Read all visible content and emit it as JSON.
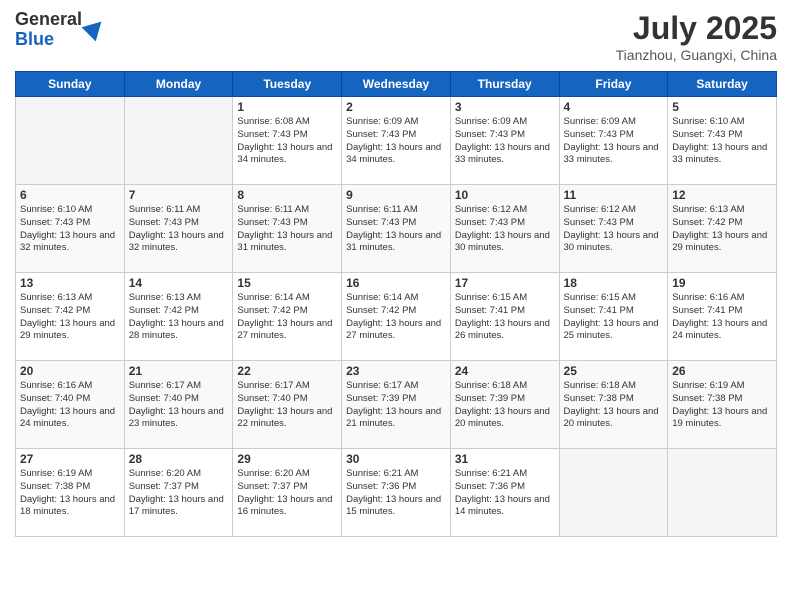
{
  "logo": {
    "general": "General",
    "blue": "Blue"
  },
  "header": {
    "month": "July 2025",
    "location": "Tianzhou, Guangxi, China"
  },
  "weekdays": [
    "Sunday",
    "Monday",
    "Tuesday",
    "Wednesday",
    "Thursday",
    "Friday",
    "Saturday"
  ],
  "weeks": [
    [
      {
        "day": "",
        "info": ""
      },
      {
        "day": "",
        "info": ""
      },
      {
        "day": "1",
        "info": "Sunrise: 6:08 AM\nSunset: 7:43 PM\nDaylight: 13 hours and 34 minutes."
      },
      {
        "day": "2",
        "info": "Sunrise: 6:09 AM\nSunset: 7:43 PM\nDaylight: 13 hours and 34 minutes."
      },
      {
        "day": "3",
        "info": "Sunrise: 6:09 AM\nSunset: 7:43 PM\nDaylight: 13 hours and 33 minutes."
      },
      {
        "day": "4",
        "info": "Sunrise: 6:09 AM\nSunset: 7:43 PM\nDaylight: 13 hours and 33 minutes."
      },
      {
        "day": "5",
        "info": "Sunrise: 6:10 AM\nSunset: 7:43 PM\nDaylight: 13 hours and 33 minutes."
      }
    ],
    [
      {
        "day": "6",
        "info": "Sunrise: 6:10 AM\nSunset: 7:43 PM\nDaylight: 13 hours and 32 minutes."
      },
      {
        "day": "7",
        "info": "Sunrise: 6:11 AM\nSunset: 7:43 PM\nDaylight: 13 hours and 32 minutes."
      },
      {
        "day": "8",
        "info": "Sunrise: 6:11 AM\nSunset: 7:43 PM\nDaylight: 13 hours and 31 minutes."
      },
      {
        "day": "9",
        "info": "Sunrise: 6:11 AM\nSunset: 7:43 PM\nDaylight: 13 hours and 31 minutes."
      },
      {
        "day": "10",
        "info": "Sunrise: 6:12 AM\nSunset: 7:43 PM\nDaylight: 13 hours and 30 minutes."
      },
      {
        "day": "11",
        "info": "Sunrise: 6:12 AM\nSunset: 7:43 PM\nDaylight: 13 hours and 30 minutes."
      },
      {
        "day": "12",
        "info": "Sunrise: 6:13 AM\nSunset: 7:42 PM\nDaylight: 13 hours and 29 minutes."
      }
    ],
    [
      {
        "day": "13",
        "info": "Sunrise: 6:13 AM\nSunset: 7:42 PM\nDaylight: 13 hours and 29 minutes."
      },
      {
        "day": "14",
        "info": "Sunrise: 6:13 AM\nSunset: 7:42 PM\nDaylight: 13 hours and 28 minutes."
      },
      {
        "day": "15",
        "info": "Sunrise: 6:14 AM\nSunset: 7:42 PM\nDaylight: 13 hours and 27 minutes."
      },
      {
        "day": "16",
        "info": "Sunrise: 6:14 AM\nSunset: 7:42 PM\nDaylight: 13 hours and 27 minutes."
      },
      {
        "day": "17",
        "info": "Sunrise: 6:15 AM\nSunset: 7:41 PM\nDaylight: 13 hours and 26 minutes."
      },
      {
        "day": "18",
        "info": "Sunrise: 6:15 AM\nSunset: 7:41 PM\nDaylight: 13 hours and 25 minutes."
      },
      {
        "day": "19",
        "info": "Sunrise: 6:16 AM\nSunset: 7:41 PM\nDaylight: 13 hours and 24 minutes."
      }
    ],
    [
      {
        "day": "20",
        "info": "Sunrise: 6:16 AM\nSunset: 7:40 PM\nDaylight: 13 hours and 24 minutes."
      },
      {
        "day": "21",
        "info": "Sunrise: 6:17 AM\nSunset: 7:40 PM\nDaylight: 13 hours and 23 minutes."
      },
      {
        "day": "22",
        "info": "Sunrise: 6:17 AM\nSunset: 7:40 PM\nDaylight: 13 hours and 22 minutes."
      },
      {
        "day": "23",
        "info": "Sunrise: 6:17 AM\nSunset: 7:39 PM\nDaylight: 13 hours and 21 minutes."
      },
      {
        "day": "24",
        "info": "Sunrise: 6:18 AM\nSunset: 7:39 PM\nDaylight: 13 hours and 20 minutes."
      },
      {
        "day": "25",
        "info": "Sunrise: 6:18 AM\nSunset: 7:38 PM\nDaylight: 13 hours and 20 minutes."
      },
      {
        "day": "26",
        "info": "Sunrise: 6:19 AM\nSunset: 7:38 PM\nDaylight: 13 hours and 19 minutes."
      }
    ],
    [
      {
        "day": "27",
        "info": "Sunrise: 6:19 AM\nSunset: 7:38 PM\nDaylight: 13 hours and 18 minutes."
      },
      {
        "day": "28",
        "info": "Sunrise: 6:20 AM\nSunset: 7:37 PM\nDaylight: 13 hours and 17 minutes."
      },
      {
        "day": "29",
        "info": "Sunrise: 6:20 AM\nSunset: 7:37 PM\nDaylight: 13 hours and 16 minutes."
      },
      {
        "day": "30",
        "info": "Sunrise: 6:21 AM\nSunset: 7:36 PM\nDaylight: 13 hours and 15 minutes."
      },
      {
        "day": "31",
        "info": "Sunrise: 6:21 AM\nSunset: 7:36 PM\nDaylight: 13 hours and 14 minutes."
      },
      {
        "day": "",
        "info": ""
      },
      {
        "day": "",
        "info": ""
      }
    ]
  ]
}
